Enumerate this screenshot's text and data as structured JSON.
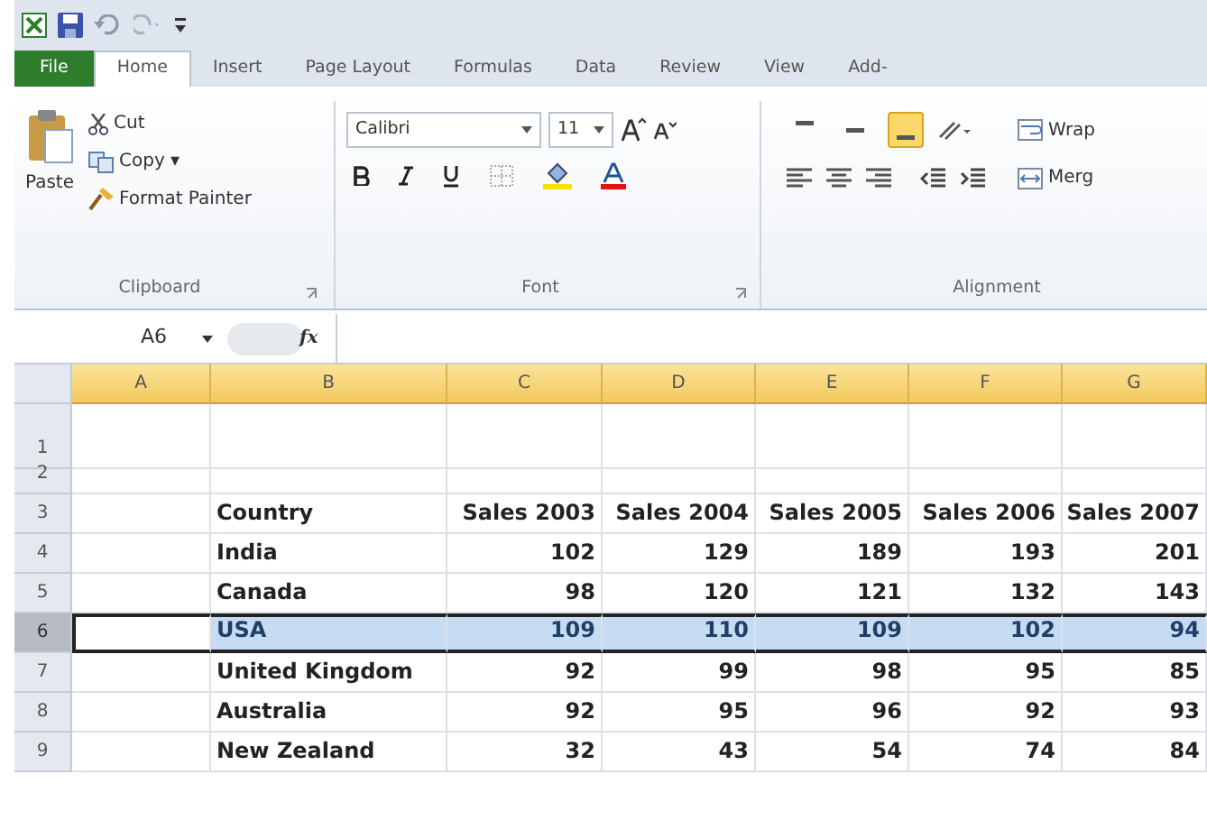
{
  "tabs": [
    {
      "label": "File",
      "kind": "file",
      "selected": false
    },
    {
      "label": "Home",
      "kind": "tab",
      "selected": true
    },
    {
      "label": "Insert",
      "kind": "tab",
      "selected": false
    },
    {
      "label": "Page Layout",
      "kind": "tab",
      "selected": false
    },
    {
      "label": "Formulas",
      "kind": "tab",
      "selected": false
    },
    {
      "label": "Data",
      "kind": "tab",
      "selected": false
    },
    {
      "label": "Review",
      "kind": "tab",
      "selected": false
    },
    {
      "label": "View",
      "kind": "tab",
      "selected": false
    },
    {
      "label": "Add-",
      "kind": "tab",
      "selected": false
    }
  ],
  "ribbon": {
    "clipboard": {
      "paste": "Paste",
      "cut": "Cut",
      "copy": "Copy ▾",
      "format_painter": "Format Painter",
      "label": "Clipboard"
    },
    "font": {
      "font_name": "Calibri",
      "font_size": "11",
      "label": "Font"
    },
    "alignment": {
      "vertical": [
        {
          "on": false
        },
        {
          "on": false
        },
        {
          "on": true
        }
      ],
      "wrap": "Wrap",
      "merge": "Merg",
      "label": "Alignment"
    }
  },
  "formula_bar": {
    "name_box": "A6",
    "fx": "fx"
  },
  "sheet": {
    "columns": [
      "A",
      "B",
      "C",
      "D",
      "E",
      "F",
      "G"
    ],
    "rows": [
      {
        "header": "1",
        "selected": false,
        "cells": {}
      },
      {
        "header": "2",
        "selected": false,
        "cells": {}
      },
      {
        "header": "3",
        "selected": false,
        "cells": {
          "B": "Country",
          "C": "Sales 2003",
          "D": "Sales 2004",
          "E": "Sales 2005",
          "F": "Sales 2006",
          "G": "Sales 2007"
        }
      },
      {
        "header": "4",
        "selected": false,
        "cells": {
          "B": "India",
          "C": "102",
          "D": "129",
          "E": "189",
          "F": "193",
          "G": "201"
        }
      },
      {
        "header": "5",
        "selected": false,
        "cells": {
          "B": "Canada",
          "C": "98",
          "D": "120",
          "E": "121",
          "F": "132",
          "G": "143"
        }
      },
      {
        "header": "6",
        "selected": true,
        "cells": {
          "B": "USA",
          "C": "109",
          "D": "110",
          "E": "109",
          "F": "102",
          "G": "94"
        }
      },
      {
        "header": "7",
        "selected": false,
        "cells": {
          "B": "United Kingdom",
          "C": "92",
          "D": "99",
          "E": "98",
          "F": "95",
          "G": "85"
        }
      },
      {
        "header": "8",
        "selected": false,
        "cells": {
          "B": "Australia",
          "C": "92",
          "D": "95",
          "E": "96",
          "F": "92",
          "G": "93"
        }
      },
      {
        "header": "9",
        "selected": false,
        "cells": {
          "B": "New Zealand",
          "C": "32",
          "D": "43",
          "E": "54",
          "F": "74",
          "G": "84"
        }
      }
    ]
  }
}
